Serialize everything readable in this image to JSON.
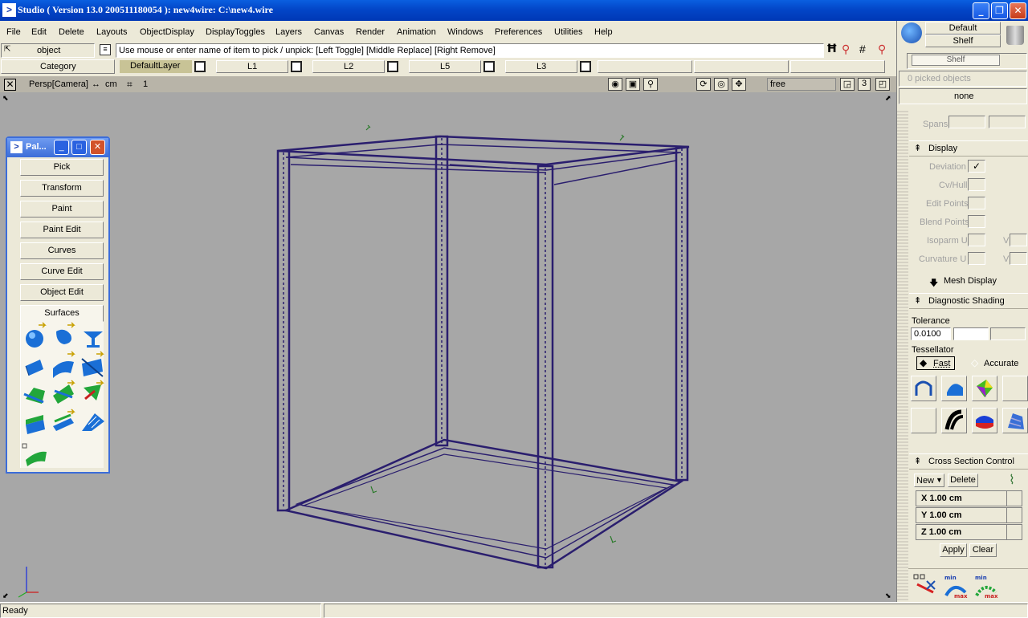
{
  "title": {
    "text": "Studio ( Version 13.0  200511180054 ): new4wire: C:\\new4.wire"
  },
  "menu": [
    "File",
    "Edit",
    "Delete",
    "Layouts",
    "ObjectDisplay",
    "DisplayToggles",
    "Layers",
    "Canvas",
    "Render",
    "Animation",
    "Windows",
    "Preferences",
    "Utilities",
    "Help"
  ],
  "pick": {
    "mode": "object",
    "prompt": "Use mouse or enter name of item to pick / unpick: [Left Toggle] [Middle Replace] [Right Remove]"
  },
  "layers": {
    "category": "Category",
    "items": [
      "DefaultLayer",
      "L1",
      "L2",
      "L5",
      "L3"
    ]
  },
  "shelf": {
    "default_label": "Default",
    "shelf_label": "Shelf",
    "tab_label": "Shelf"
  },
  "viewport": {
    "camera_label": "Persp[Camera]",
    "units": "cm",
    "grid_label": "1",
    "mode_field": "free",
    "count": "3"
  },
  "palette": {
    "title": "Pal...",
    "buttons": [
      "Pick",
      "Transform",
      "Paint",
      "Paint Edit",
      "Curves",
      "Curve Edit",
      "Object Edit"
    ],
    "active_tab": "Surfaces",
    "tools": [
      "sphere-primitive-icon",
      "revolve-icon",
      "skin-icon",
      "extrude-icon",
      "boundary-icon",
      "rail-icon",
      "square-icon",
      "birail-icon",
      "fillet-icon",
      "offset-icon",
      "draft-icon",
      "ruled-icon",
      "tube-icon"
    ]
  },
  "right": {
    "picked": "0 picked objects",
    "none": "none",
    "spans": "Spans",
    "display": {
      "title": "Display",
      "items": [
        "Deviation",
        "Cv/Hull",
        "Edit Points",
        "Blend Points",
        "Isoparm U",
        "Curvature U"
      ],
      "v_label": "V",
      "deviation_checked": true
    },
    "mesh_display": "Mesh Display",
    "diag": {
      "title": "Diagnostic Shading",
      "tolerance_label": "Tolerance",
      "tolerance_value": "0.0100",
      "tessellator_label": "Tessellator",
      "fast": "Fast",
      "accurate": "Accurate"
    },
    "cross": {
      "title": "Cross Section Control",
      "new": "New",
      "delete": "Delete",
      "x": "X 1.00 cm",
      "y": "Y 1.00 cm",
      "z": "Z 1.00 cm",
      "apply": "Apply",
      "clear": "Clear"
    }
  },
  "status": {
    "text": "Ready"
  },
  "colors": {
    "wire": "#2a1e6e",
    "viewport_bg": "#a7a7a7",
    "title_blue": "#0346c8"
  }
}
